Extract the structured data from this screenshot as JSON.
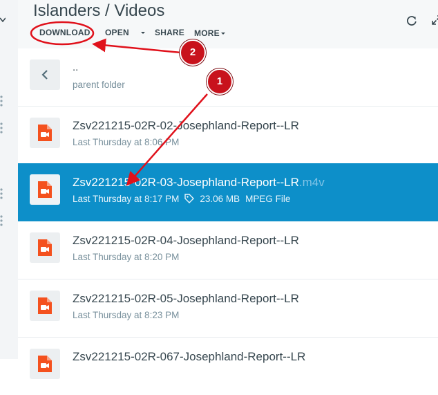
{
  "header": {
    "title": "Islanders / Videos",
    "toolbar": {
      "download": "DOWNLOAD",
      "open": "OPEN",
      "share": "SHARE",
      "more": "MORE"
    }
  },
  "files": [
    {
      "name": "..",
      "meta": "parent folder",
      "type": "parent"
    },
    {
      "name": "Zsv221215-02R-02-Josephland-Report--LR",
      "date": "Last Thursday at 8:06 PM",
      "type": "video"
    },
    {
      "name": "Zsv221215-02R-03-Josephland-Report--LR",
      "ext": ".m4v",
      "date": "Last Thursday at 8:17 PM",
      "size": "23.06 MB",
      "kind": "MPEG File",
      "type": "video",
      "selected": true
    },
    {
      "name": "Zsv221215-02R-04-Josephland-Report--LR",
      "date": "Last Thursday at 8:20 PM",
      "type": "video"
    },
    {
      "name": "Zsv221215-02R-05-Josephland-Report--LR",
      "date": "Last Thursday at 8:23 PM",
      "type": "video"
    },
    {
      "name": "Zsv221215-02R-067-Josephland-Report--LR",
      "date": "",
      "type": "video"
    }
  ],
  "annotations": {
    "step1": "1",
    "step2": "2",
    "color": "#e0111b"
  },
  "colors": {
    "selected_row": "#0d8fc9",
    "file_icon": "#f4511e",
    "text": "#37474f"
  }
}
